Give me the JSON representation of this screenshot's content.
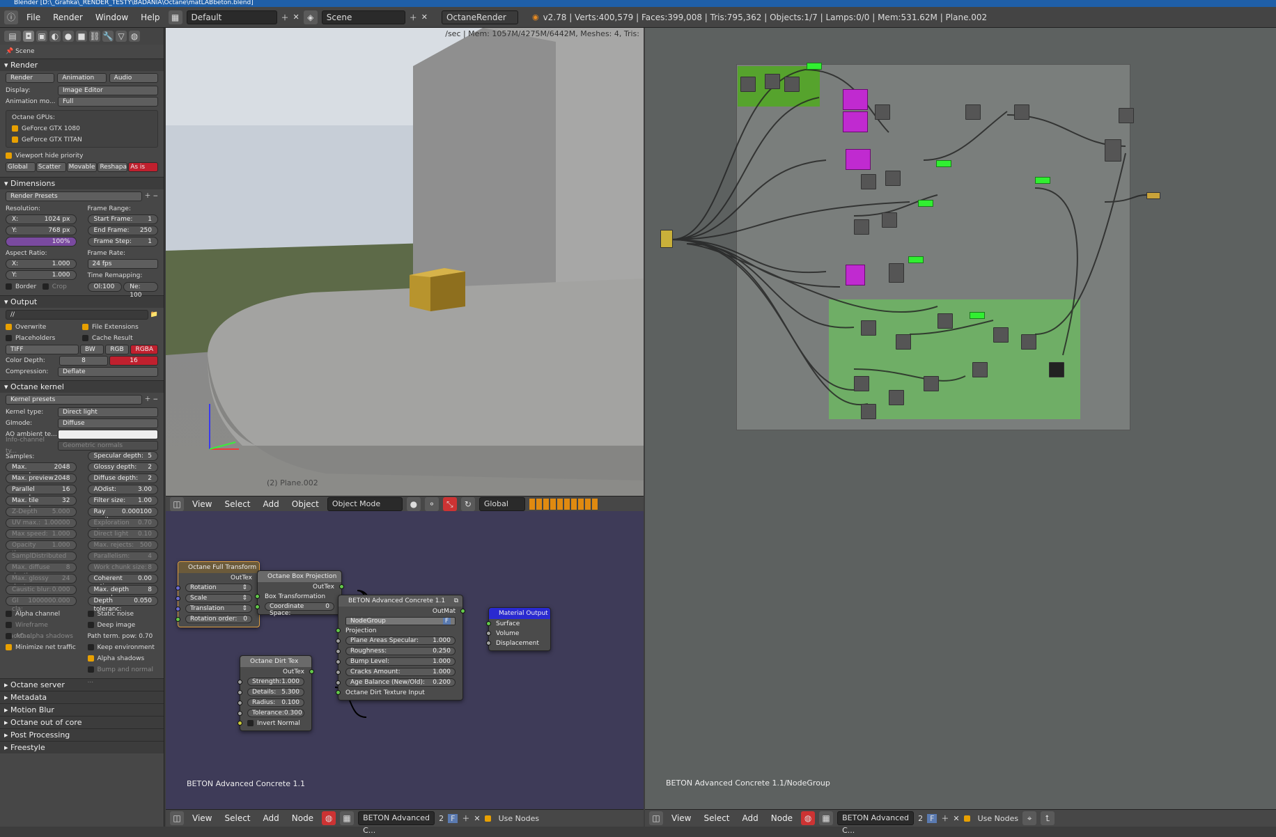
{
  "title_bar": "Blender [D:\\_Grafika\\_RENDER_TESTY\\BADANIA\\Octane\\matLABbeton.blend]",
  "top": {
    "menus": [
      "File",
      "Render",
      "Window",
      "Help"
    ],
    "layout": "Default",
    "scene": "Scene",
    "engine": "OctaneRender",
    "stats": "v2.78 | Verts:400,579 | Faces:399,008 | Tris:795,362 | Objects:1/7 | Lamps:0/0 | Mem:531.62M | Plane.002"
  },
  "left": {
    "breadcrumb": "Scene",
    "render": {
      "header": "Render",
      "buttons": [
        "Render",
        "Animation",
        "Audio"
      ],
      "display_label": "Display:",
      "display": "Image Editor",
      "anim_label": "Animation mo...",
      "anim": "Full",
      "gpus_label": "Octane GPUs:",
      "gpus": [
        "GeForce GTX 1080",
        "GeForce GTX TITAN"
      ],
      "viewport_hide": "Viewport hide priority",
      "priority": [
        "Global",
        "Scatter",
        "Movable",
        "Reshapabl",
        "As is"
      ]
    },
    "dimensions": {
      "header": "Dimensions",
      "presets": "Render Presets",
      "resolution": "Resolution:",
      "x": "1024 px",
      "y": "768 px",
      "pct": "100%",
      "frame_range": "Frame Range:",
      "start": "1",
      "end": "250",
      "step": "1",
      "aspect": "Aspect Ratio:",
      "ax": "1.000",
      "ay": "1.000",
      "frame_rate": "Frame Rate:",
      "fps": "24 fps",
      "time_remap": "Time Remapping:",
      "old": "Ol:100",
      "new": "Ne: 100",
      "border": "Border",
      "crop": "Crop"
    },
    "output": {
      "header": "Output",
      "path": "//",
      "overwrite": "Overwrite",
      "file_ext": "File Extensions",
      "placeholders": "Placeholders",
      "cache": "Cache Result",
      "format": "TIFF",
      "bw": "BW",
      "rgb": "RGB",
      "rgba": "RGBA",
      "depth_label": "Color Depth:",
      "d8": "8",
      "d16": "16",
      "comp_label": "Compression:",
      "comp": "Deflate"
    },
    "kernel": {
      "header": "Octane kernel",
      "presets": "Kernel presets",
      "type_label": "Kernel type:",
      "type": "Direct light",
      "gi_label": "GImode:",
      "gi": "Diffuse",
      "ao_label": "AO ambient te...",
      "info_label": "Info-channel ty...",
      "info": "Geometric normals",
      "samples_label": "Samples:",
      "left_fields": [
        [
          "Max. samples:",
          "2048"
        ],
        [
          "Max. preview :",
          "2048"
        ],
        [
          "Parallel samples:",
          "16"
        ],
        [
          "Max. tile samples:",
          "32"
        ],
        [
          "Z-Depth max.:",
          "5.000"
        ],
        [
          "UV max.:",
          "1.00000"
        ],
        [
          "Max speed:",
          "1.000"
        ],
        [
          "Opacity thres:",
          "1.000"
        ],
        [
          "Sampl",
          "Distributed r..."
        ],
        [
          "Max. diffuse depth:",
          "8"
        ],
        [
          "Max. glossy dept:",
          "24"
        ],
        [
          "Caustic blur:",
          "0.000"
        ],
        [
          "GI cla:",
          "1000000.000"
        ]
      ],
      "right_fields": [
        [
          "Specular depth:",
          "5"
        ],
        [
          "Glossy depth:",
          "2"
        ],
        [
          "Diffuse depth:",
          "2"
        ],
        [
          "AOdist:",
          "3.00"
        ],
        [
          "Filter size:",
          "1.00"
        ],
        [
          "Ray epsilo:",
          "0.000100"
        ],
        [
          "Exploration stre:",
          "0.70"
        ],
        [
          "Direct light imp:",
          "0.10"
        ],
        [
          "Max. rejects:",
          "500"
        ],
        [
          "Parallelism:",
          "4"
        ],
        [
          "Work chunk size:",
          "8"
        ],
        [
          "Coherent ratio:",
          "0.00"
        ],
        [
          "Max. depth sampl:",
          "8"
        ],
        [
          "Depth toleranc:",
          "0.050"
        ]
      ],
      "checks_left": [
        "Alpha channel",
        "Wireframe backfac...",
        "AO alpha shadows",
        "Minimize net traffic"
      ],
      "checks_right": [
        "Static noise",
        "Deep image",
        "Path term. pow: 0.70",
        "Keep environment",
        "Alpha shadows",
        "Bump and normal ..."
      ]
    },
    "collapsed": [
      "Octane server",
      "Metadata",
      "Motion Blur",
      "Octane out of core",
      "Post Processing",
      "Freestyle"
    ]
  },
  "viewport": {
    "info": "/sec | Mem: 1057M/4275M/6442M, Meshes: 4, Tris:",
    "object_label": "(2) Plane.002",
    "menus": [
      "View",
      "Select",
      "Add",
      "Object"
    ],
    "mode": "Object Mode",
    "orientation": "Global"
  },
  "node_left": {
    "label": "BETON Advanced Concrete 1.1",
    "menus": [
      "View",
      "Select",
      "Add",
      "Node"
    ],
    "material": "BETON Advanced C...",
    "users": "2",
    "fake": "F",
    "use_nodes": "Use Nodes",
    "nodes": {
      "transform": {
        "title": "Octane Full Transform",
        "out": "OutTex",
        "rows": [
          "Rotation",
          "Scale",
          "Translation"
        ],
        "order_label": "Rotation order:",
        "order": "0"
      },
      "boxproj": {
        "title": "Octane Box Projection",
        "out": "OutTex",
        "row": "Box Transformation",
        "space_label": "Coordinate Space:",
        "space": "0"
      },
      "concrete": {
        "title": "BETON Advanced Concrete 1.1",
        "out": "OutMat",
        "group": "NodeGroup",
        "proj": "Projection",
        "fields": [
          [
            "Plane Areas Specular:",
            "1.000"
          ],
          [
            "Roughness:",
            "0.250"
          ],
          [
            "Bump Level:",
            "1.000"
          ],
          [
            "Cracks Amount:",
            "1.000"
          ],
          [
            "Age Balance (New/Old):",
            "0.200"
          ]
        ],
        "last": "Octane Dirt Texture Input"
      },
      "dirt": {
        "title": "Octane Dirt Tex",
        "out": "OutTex",
        "fields": [
          [
            "Strength:",
            "1.000"
          ],
          [
            "Details:",
            "5.300"
          ],
          [
            "Radius:",
            "0.100"
          ],
          [
            "Tolerance:",
            "0.300"
          ]
        ],
        "invert": "Invert Normal"
      },
      "output": {
        "title": "Material Output",
        "rows": [
          "Surface",
          "Volume",
          "Displacement"
        ]
      }
    }
  },
  "node_right": {
    "label": "BETON Advanced Concrete 1.1/NodeGroup",
    "menus": [
      "View",
      "Select",
      "Add",
      "Node"
    ],
    "material": "BETON Advanced C...",
    "users": "2",
    "fake": "F",
    "use_nodes": "Use Nodes"
  }
}
